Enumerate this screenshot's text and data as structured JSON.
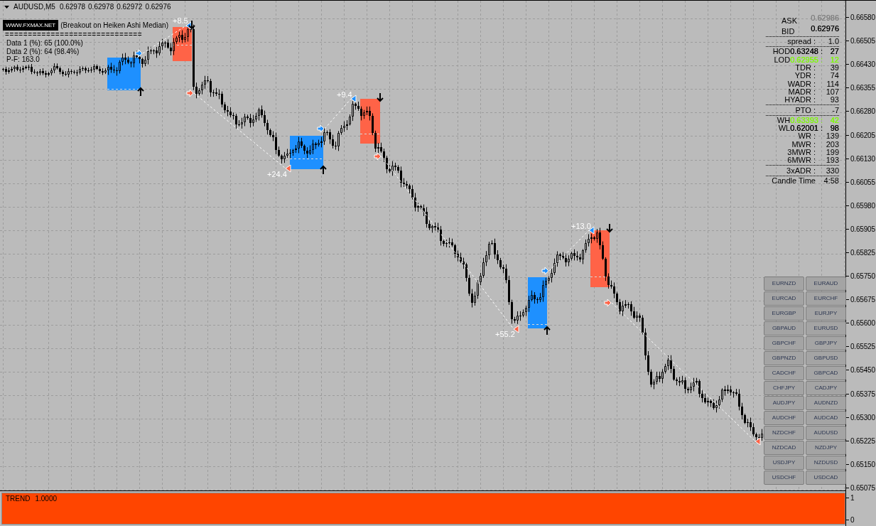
{
  "chart_header": {
    "symbol": "AUDUSD,M5",
    "prices": [
      "0.62978",
      "0.62978",
      "0.62972",
      "0.62976"
    ]
  },
  "indicator": {
    "badge": "WWW.FXMAX.NET",
    "title": "(Breakout on Heiken Ashi Median)",
    "divider": "==============================",
    "lines": [
      "Data 1 (%): 65 (100.0%)",
      "Data 2 (%): 64 (98.4%)",
      "P-F: 163.0"
    ]
  },
  "signals": [
    {
      "kind": "buy",
      "result": "+8.5"
    },
    {
      "kind": "sell",
      "result": "+24.4"
    },
    {
      "kind": "buy",
      "result": "+9.4"
    },
    {
      "kind": "sell",
      "result": "+55.2"
    },
    {
      "kind": "buy",
      "result": "+13.0"
    },
    {
      "kind": "sell"
    }
  ],
  "info_panel": {
    "quotes": [
      {
        "label": "ASK",
        "value": "0.62986",
        "color": "#808080"
      },
      {
        "label": "BID",
        "value": "0.62976",
        "color": "#000000"
      }
    ],
    "groups": [
      [
        {
          "label": "spread :",
          "value": "1.0"
        }
      ],
      [
        {
          "label": "HOD",
          "price": "0.63248 :",
          "value": "27",
          "color": "#000000"
        },
        {
          "label": "LOD",
          "price": "0.62955 :",
          "value": "12",
          "color": "#7cfc00"
        },
        {
          "label": "TDR :",
          "value": "39"
        },
        {
          "label": "YDR :",
          "value": "74"
        },
        {
          "label": "WADR :",
          "value": "114"
        },
        {
          "label": "MADR :",
          "value": "107"
        },
        {
          "label": "HYADR :",
          "value": "93"
        }
      ],
      [
        {
          "label": "PTO :",
          "value": "-7"
        }
      ],
      [
        {
          "label": "WH",
          "price": "0.63393 :",
          "value": "42",
          "color": "#7cfc00"
        },
        {
          "label": "WL",
          "price": "0.62001 :",
          "value": "98",
          "color": "#000000"
        },
        {
          "label": "WR :",
          "value": "139"
        },
        {
          "label": "MWR :",
          "value": "203"
        },
        {
          "label": "3MWR :",
          "value": "199"
        },
        {
          "label": "6MWR :",
          "value": "193"
        }
      ],
      [
        {
          "label": "3xADR :",
          "value": "330"
        }
      ],
      [
        {
          "label": "Candle Time",
          "value": "4:58"
        }
      ]
    ]
  },
  "symbol_buttons": [
    "EURNZD",
    "EURAUD",
    "EURCAD",
    "EURCHF",
    "EURGBP",
    "EURJPY",
    "GBPAUD",
    "EURUSD",
    "GBPCHF",
    "GBPJPY",
    "GBPNZD",
    "GBPUSD",
    "CADCHF",
    "GBPCAD",
    "CHFJPY",
    "CADJPY",
    "AUDJPY",
    "AUDNZD",
    "AUDCHF",
    "AUDCAD",
    "NZDCHF",
    "AUDUSD",
    "NZDCAD",
    "NZDJPY",
    "USDJPY",
    "NZDUSD",
    "USDCHF",
    "USDCAD"
  ],
  "price_axis": [
    "0.66580",
    "0.66505",
    "0.66430",
    "0.66355",
    "0.66280",
    "0.66205",
    "0.66130",
    "0.66055",
    "0.65980",
    "0.65905",
    "0.65825",
    "0.65750",
    "0.65675",
    "0.65600",
    "0.65525",
    "0.65450",
    "0.65375",
    "0.65300",
    "0.65225",
    "0.65150",
    "0.65075"
  ],
  "trend_pane": {
    "name": "TREND",
    "value": "1.0000",
    "level": 1,
    "scale": [
      "1",
      "0"
    ]
  }
}
